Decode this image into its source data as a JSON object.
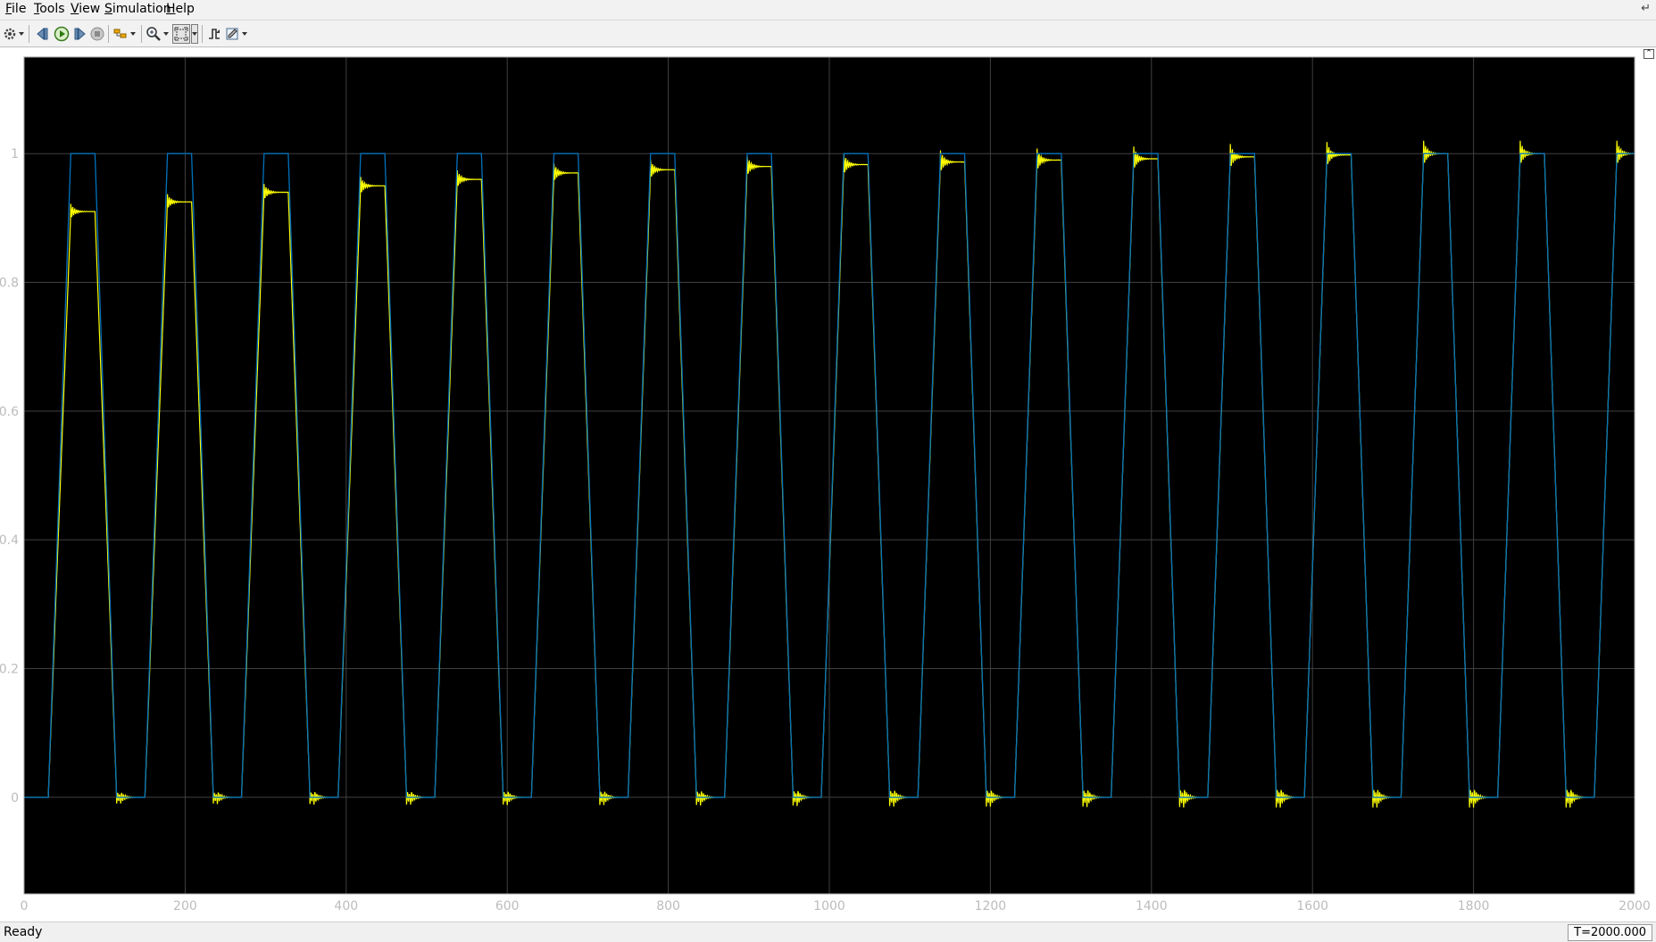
{
  "menubar": {
    "items": [
      {
        "label": "File",
        "underline": "F",
        "rest": "ile"
      },
      {
        "label": "Tools",
        "underline": "T",
        "rest": "ools"
      },
      {
        "label": "View",
        "underline": "V",
        "rest": "iew"
      },
      {
        "label": "Simulation",
        "underline": "S",
        "rest": "imulation"
      },
      {
        "label": "Help",
        "underline": "H",
        "rest": "elp"
      }
    ]
  },
  "toolbar": {
    "buttons": [
      {
        "name": "settings-gear-icon"
      },
      {
        "name": "step-back-icon"
      },
      {
        "name": "run-icon"
      },
      {
        "name": "step-forward-icon"
      },
      {
        "name": "stop-icon"
      },
      {
        "name": "highlight-icon"
      },
      {
        "name": "zoom-icon"
      },
      {
        "name": "autoscale-icon"
      },
      {
        "name": "triggers-icon"
      },
      {
        "name": "cursor-measurements-icon"
      }
    ]
  },
  "colors": {
    "plot_background": "#000000",
    "grid": "#404040",
    "axis_text": "#bcbcbc",
    "series_yellow": "#ffff00",
    "series_blue": "#0072bd"
  },
  "chart_data": {
    "type": "line",
    "title": "",
    "xlabel": "",
    "ylabel": "",
    "xlim": [
      0,
      2000
    ],
    "ylim": [
      -0.15,
      1.15
    ],
    "xticks": [
      0,
      200,
      400,
      600,
      800,
      1000,
      1200,
      1400,
      1600,
      1800,
      2000
    ],
    "yticks": [
      0,
      0.2,
      0.4,
      0.6,
      0.8,
      1
    ],
    "ytick_labels": [
      "0",
      "0.2",
      "0.4",
      "0.6",
      "0.8",
      "1"
    ],
    "grid": true,
    "legend": "none",
    "period": 120,
    "cycle_shape": {
      "rise_start": 30,
      "rise_end": 58,
      "high_end": 88,
      "fall_end": 115
    },
    "series": [
      {
        "color": "#ffff00",
        "style": "reference trapezoid; settles below 1 with small overshoot ringing that grows each cycle",
        "plateau_levels": [
          0.91,
          0.925,
          0.94,
          0.95,
          0.96,
          0.97,
          0.975,
          0.98,
          0.983,
          0.987,
          0.99,
          0.992,
          0.995,
          0.998,
          1.0,
          1.0,
          1.0
        ],
        "ringing_amplitude": [
          0.012,
          0.012,
          0.013,
          0.014,
          0.014,
          0.015,
          0.015,
          0.016,
          0.017,
          0.018,
          0.018,
          0.019,
          0.02,
          0.02,
          0.02,
          0.02,
          0.02
        ]
      },
      {
        "color": "#0072bd",
        "style": "trapezoidal wave between 0 and 1",
        "low": 0,
        "high": 1
      }
    ]
  },
  "status": {
    "text": "Ready",
    "time": "T=2000.000"
  }
}
